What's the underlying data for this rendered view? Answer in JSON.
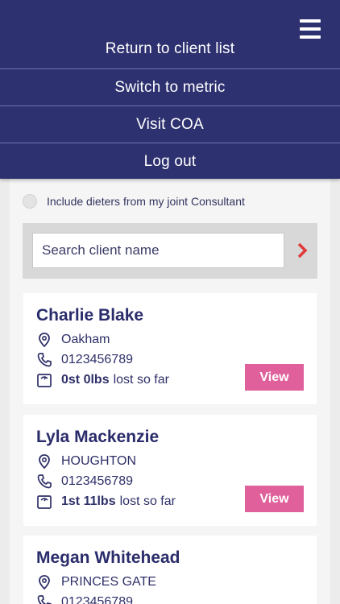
{
  "menu": {
    "items": [
      {
        "label": "Return to client list"
      },
      {
        "label": "Switch to metric"
      },
      {
        "label": "Visit COA"
      },
      {
        "label": "Log out"
      }
    ],
    "icon": "hamburger-menu-icon"
  },
  "filters": {
    "include_joint_label": "Include dieters from my joint Consultant",
    "include_joint_checked": false
  },
  "search": {
    "placeholder": "Search client name",
    "go_icon": "chevron-right-icon"
  },
  "clients": [
    {
      "name": "Charlie Blake",
      "location": "Oakham",
      "phone": "0123456789",
      "lost": "0st 0lbs",
      "lost_suffix": "lost so far",
      "view_label": "View"
    },
    {
      "name": "Lyla Mackenzie",
      "location": "HOUGHTON",
      "phone": "0123456789",
      "lost": "1st 11lbs",
      "lost_suffix": "lost so far",
      "view_label": "View"
    },
    {
      "name": "Megan Whitehead",
      "location": "PRINCES GATE",
      "phone": "0123456789"
    }
  ],
  "colors": {
    "primary": "#2e3170",
    "accent_pink": "#e0609b",
    "accent_red": "#e03a3a",
    "background": "#ececec"
  }
}
